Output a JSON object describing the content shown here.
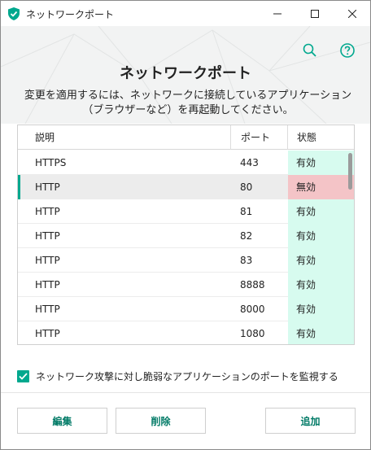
{
  "window": {
    "title": "ネットワークポート",
    "controls": [
      "minimize-icon",
      "maximize-icon",
      "close-icon"
    ]
  },
  "header": {
    "icons": [
      "search-icon",
      "help-icon"
    ],
    "title": "ネットワークポート",
    "description": "変更を適用するには、ネットワークに接続しているアプリケーション（ブラウザーなど）を再起動してください。"
  },
  "table": {
    "columns": {
      "description": "説明",
      "port": "ポート",
      "status": "状態"
    },
    "rows": [
      {
        "description": "HTTPS",
        "port": "443",
        "status": "有効",
        "state": "on",
        "selected": false
      },
      {
        "description": "HTTP",
        "port": "80",
        "status": "無効",
        "state": "off",
        "selected": true
      },
      {
        "description": "HTTP",
        "port": "81",
        "status": "有効",
        "state": "on",
        "selected": false
      },
      {
        "description": "HTTP",
        "port": "82",
        "status": "有効",
        "state": "on",
        "selected": false
      },
      {
        "description": "HTTP",
        "port": "83",
        "status": "有効",
        "state": "on",
        "selected": false
      },
      {
        "description": "HTTP",
        "port": "8888",
        "status": "有効",
        "state": "on",
        "selected": false
      },
      {
        "description": "HTTP",
        "port": "8000",
        "status": "有効",
        "state": "on",
        "selected": false
      },
      {
        "description": "HTTP",
        "port": "1080",
        "status": "有効",
        "state": "on",
        "selected": false
      }
    ]
  },
  "monitor_option": {
    "label": "ネットワーク攻撃に対し脆弱なアプリケーションのポートを監視する",
    "checked": true
  },
  "buttons": {
    "edit": "編集",
    "delete": "削除",
    "add": "追加"
  },
  "colors": {
    "accent": "#00a88e",
    "button_text": "#007a66",
    "enabled_bg": "#d7fbef",
    "disabled_bg": "#f4c4c7"
  }
}
